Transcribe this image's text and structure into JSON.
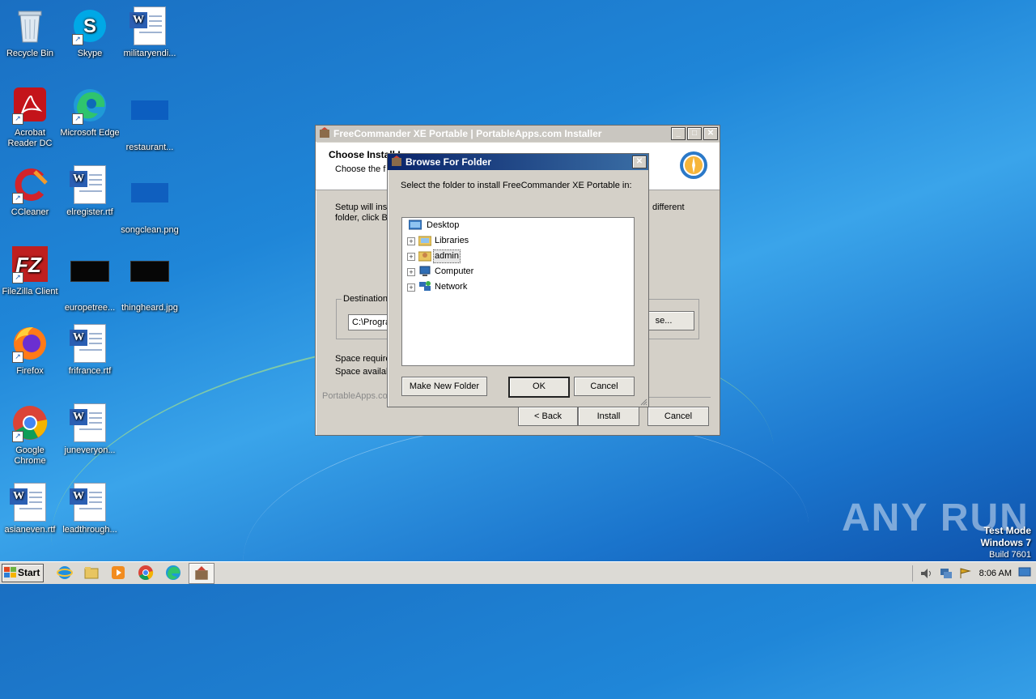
{
  "desktop": {
    "icons": [
      {
        "label": "Recycle Bin",
        "icon": "recycle-bin-icon"
      },
      {
        "label": "Skype",
        "icon": "skype-icon"
      },
      {
        "label": "militaryendi...",
        "icon": "word-doc-icon"
      },
      {
        "label": "Acrobat Reader DC",
        "icon": "acrobat-icon"
      },
      {
        "label": "Microsoft Edge",
        "icon": "edge-icon"
      },
      {
        "label": "restaurant...",
        "icon": "image-file-icon"
      },
      {
        "label": "CCleaner",
        "icon": "ccleaner-icon"
      },
      {
        "label": "elregister.rtf",
        "icon": "word-doc-icon"
      },
      {
        "label": "songclean.png",
        "icon": "image-file-icon"
      },
      {
        "label": "FileZilla Client",
        "icon": "filezilla-icon"
      },
      {
        "label": "europetree...",
        "icon": "image-file-icon"
      },
      {
        "label": "thingheard.jpg",
        "icon": "image-file-icon"
      },
      {
        "label": "Firefox",
        "icon": "firefox-icon"
      },
      {
        "label": "frifrance.rtf",
        "icon": "word-doc-icon"
      },
      {
        "label": "Google Chrome",
        "icon": "chrome-icon"
      },
      {
        "label": "juneveryon...",
        "icon": "word-doc-icon"
      },
      {
        "label": "asianeven.rtf",
        "icon": "word-doc-icon"
      },
      {
        "label": "leadthrough...",
        "icon": "word-doc-icon"
      }
    ]
  },
  "installer": {
    "title": "FreeCommander XE Portable | PortableApps.com Installer",
    "heading": "Choose Install Location",
    "heading_visible": "Choose Install L",
    "subheading_visible": "Choose the f",
    "body_left": "Setup will inst",
    "body_left2": "folder, click B",
    "body_right": "different",
    "destination_label": "Destination",
    "destination_value": "C:\\Progra",
    "browse_label_visible": "se...",
    "space_required": "Space require",
    "space_available": "Space availab",
    "brand": "PortableApps.co",
    "back_label": "< Back",
    "install_label": "Install",
    "cancel_label": "Cancel"
  },
  "browse_dialog": {
    "title": "Browse For Folder",
    "prompt": "Select the folder to install FreeCommander XE Portable in:",
    "tree": [
      {
        "label": "Desktop",
        "icon": "desktop-folder-icon",
        "expandable": false
      },
      {
        "label": "Libraries",
        "icon": "libraries-icon",
        "expandable": true
      },
      {
        "label": "admin",
        "icon": "user-folder-icon",
        "expandable": true
      },
      {
        "label": "Computer",
        "icon": "computer-icon",
        "expandable": true
      },
      {
        "label": "Network",
        "icon": "network-icon",
        "expandable": true
      }
    ],
    "make_new_folder": "Make New Folder",
    "ok": "OK",
    "cancel": "Cancel"
  },
  "watermark": {
    "brand": "ANY RUN",
    "line1": "Test Mode",
    "line2": "Windows 7",
    "line3": "Build 7601"
  },
  "taskbar": {
    "start_label": "Start",
    "clock": "8:06 AM",
    "pinned": [
      "ie-icon",
      "explorer-icon",
      "media-player-icon",
      "chrome-icon",
      "edge-icon",
      "installer-icon"
    ]
  }
}
